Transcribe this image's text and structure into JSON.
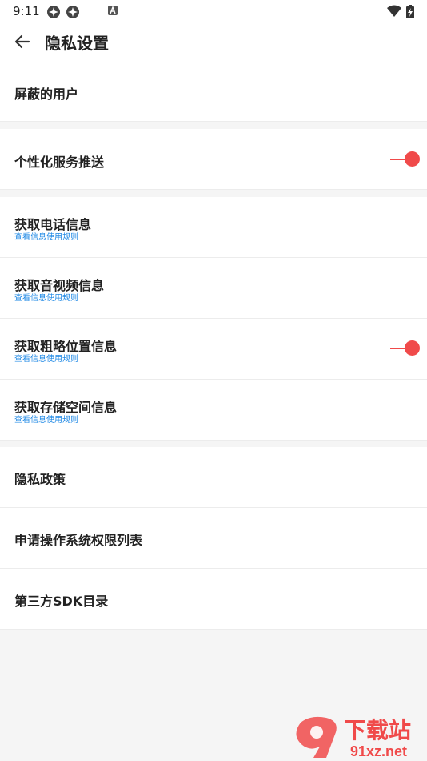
{
  "status_bar": {
    "time": "9:11"
  },
  "header": {
    "title": "隐私设置"
  },
  "rows": [
    {
      "label": "屏蔽的用户"
    },
    {
      "label": "个性化服务推送",
      "toggle_on": true
    },
    {
      "label": "获取电话信息",
      "sub": "查看信息使用规则"
    },
    {
      "label": "获取音视频信息",
      "sub": "查看信息使用规则"
    },
    {
      "label": "获取粗略位置信息",
      "sub": "查看信息使用规则",
      "toggle_on": true
    },
    {
      "label": "获取存储空间信息",
      "sub": "查看信息使用规则"
    },
    {
      "label": "隐私政策"
    },
    {
      "label": "申请操作系统权限列表"
    },
    {
      "label": "第三方SDK目录"
    }
  ],
  "watermark": {
    "big": "下载站",
    "small": "91xz.net"
  },
  "colors": {
    "accent": "#f04a4a",
    "link": "#1e88e5"
  }
}
